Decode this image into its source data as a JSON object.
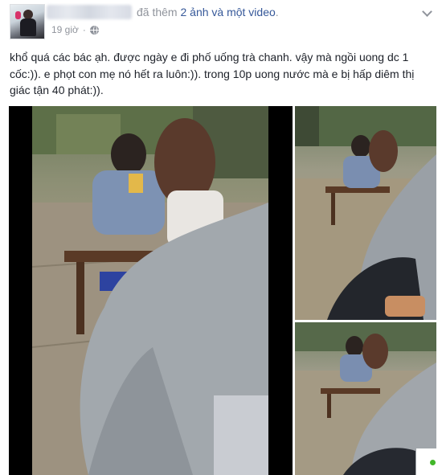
{
  "post": {
    "author_name_redacted": true,
    "headline_prefix": "đã thêm ",
    "headline_link": "2 ảnh và một video",
    "headline_suffix": ".",
    "timestamp": "19 giờ",
    "audience_icon": "globe-icon",
    "options_icon": "chevron-down-icon",
    "text": "khổ quá các bác ạh. được ngày e đi phố uống trà chanh. vậy mà ngồi uong dc 1 cốc:)). e phọt con mẹ nó hết ra luôn:)). trong 10p uong nước mà e bị hấp diêm thị giác tận 40 phát:))."
  },
  "media": {
    "video": {
      "kind": "video"
    },
    "photos": [
      {
        "kind": "photo"
      },
      {
        "kind": "photo"
      }
    ]
  },
  "status": {
    "online_color": "#42b72a"
  },
  "colors": {
    "link": "#365899",
    "meta": "#90949c",
    "text": "#1d2129"
  }
}
